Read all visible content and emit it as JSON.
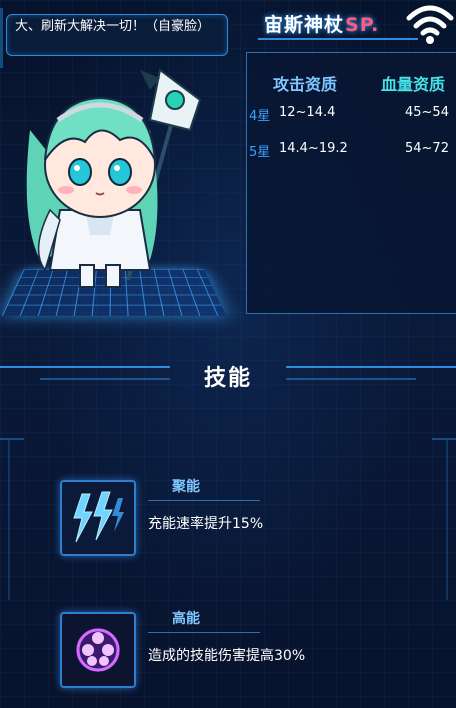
{
  "speech": {
    "text": "大、刷新大解决一切！（自豪脸）"
  },
  "header": {
    "title": "宙斯神杖",
    "title_suffix": "SP."
  },
  "stats": {
    "attack_label": "攻击资质",
    "hp_label": "血量资质",
    "rows": [
      {
        "star": "4星",
        "attack": "12~14.4",
        "hp": "45~54"
      },
      {
        "star": "5星",
        "attack": "14.4~19.2",
        "hp": "54~72"
      }
    ]
  },
  "skills_section": {
    "title": "技能"
  },
  "skills": [
    {
      "name": "聚能",
      "desc": "充能速率提升15%",
      "icon": "lightning-icon"
    },
    {
      "name": "高能",
      "desc": "造成的技能伤害提高30%",
      "icon": "energy-orb-icon"
    }
  ],
  "colors": {
    "accent": "#2f8be0",
    "attack_label": "#7fc7ff",
    "hp_label": "#45e3e8",
    "sp_suffix": "#ff5b7e",
    "background": "#07122a"
  }
}
